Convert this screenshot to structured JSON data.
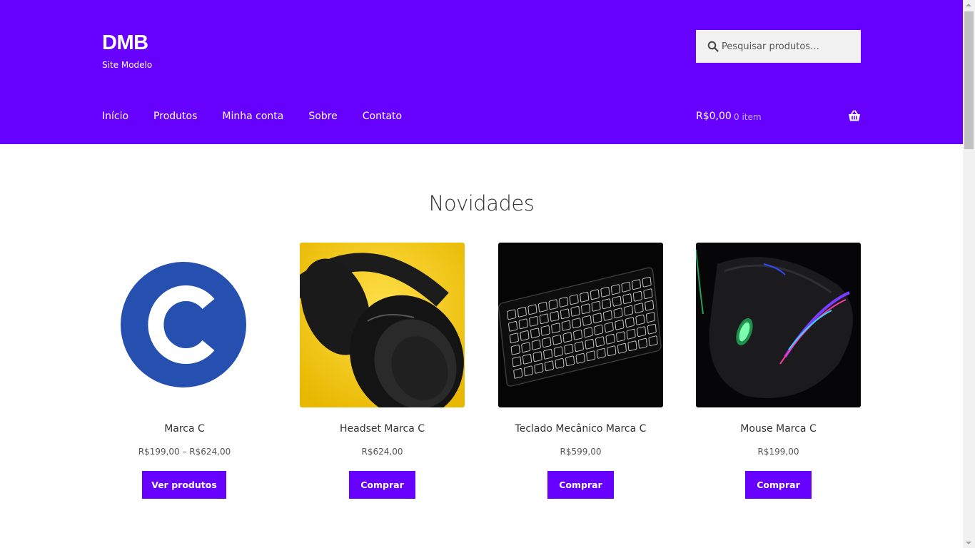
{
  "site": {
    "title": "DMB",
    "tagline": "Site Modelo"
  },
  "search": {
    "placeholder": "Pesquisar produtos…"
  },
  "nav": {
    "items": [
      {
        "label": "Início"
      },
      {
        "label": "Produtos"
      },
      {
        "label": "Minha conta"
      },
      {
        "label": "Sobre"
      },
      {
        "label": "Contato"
      }
    ]
  },
  "cart": {
    "total": "R$0,00",
    "count": "0 item",
    "icon": "basket-icon"
  },
  "section": {
    "title": "Novidades"
  },
  "products": [
    {
      "name": "Marca C",
      "price": "R$199,00 – R$624,00",
      "button": "Ver produtos",
      "image": "brand-c-logo"
    },
    {
      "name": "Headset Marca C",
      "price": "R$624,00",
      "button": "Comprar",
      "image": "headset-photo"
    },
    {
      "name": "Teclado Mecânico Marca C",
      "price": "R$599,00",
      "button": "Comprar",
      "image": "keyboard-photo"
    },
    {
      "name": "Mouse Marca C",
      "price": "R$199,00",
      "button": "Comprar",
      "image": "mouse-photo"
    }
  ],
  "colors": {
    "header_bg": "#6600ff",
    "button_bg": "#6600ff",
    "brand_c_blue": "#2550b0"
  }
}
